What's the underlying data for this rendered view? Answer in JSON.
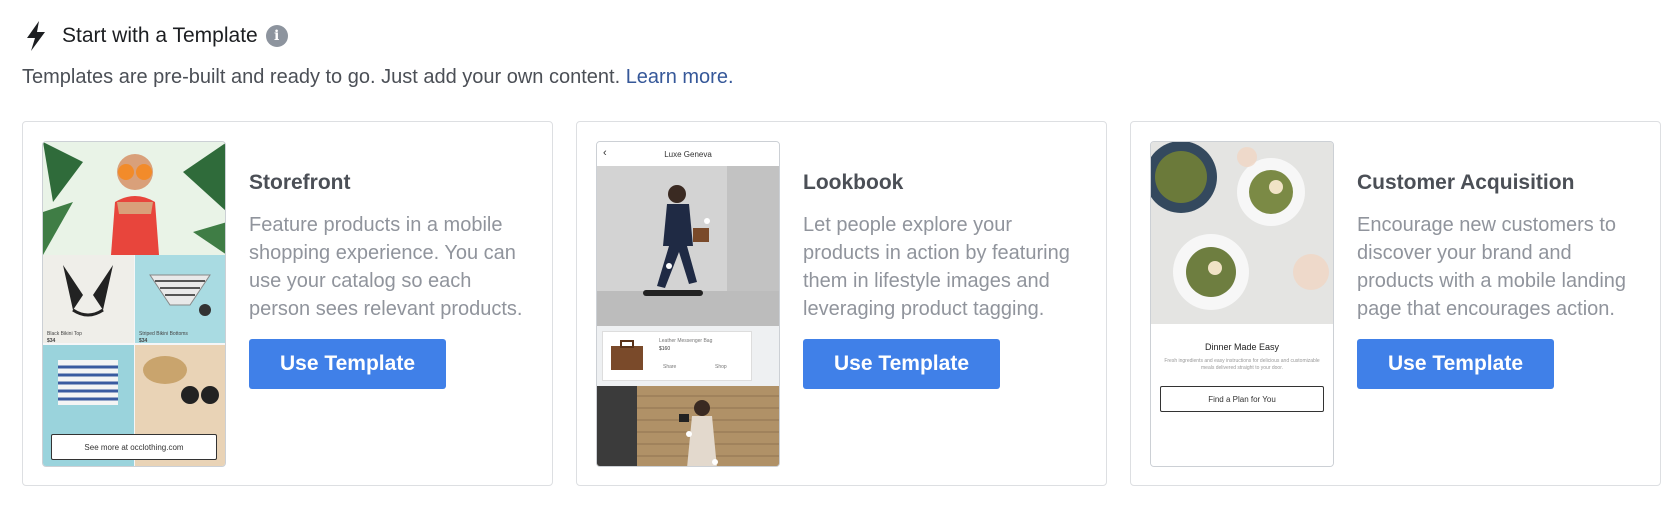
{
  "header": {
    "title": "Start with a Template",
    "info_icon": "info-icon",
    "bolt_icon": "lightning-bolt-icon"
  },
  "subtitle": {
    "text": "Templates are pre-built and ready to go. Just add your own content.",
    "link": "Learn more."
  },
  "colors": {
    "button": "#4080e8",
    "link": "#365899",
    "title": "#4b4f56",
    "desc": "#90949c"
  },
  "cards": [
    {
      "title": "Storefront",
      "description": "Feature products in a mobile shopping experience. You can use your catalog so each person sees relevant products.",
      "button": "Use Template",
      "preview": {
        "item1": "Black Bikini Top",
        "item1_price": "$34",
        "item2": "Striped Bikini Bottoms",
        "item2_price": "$34",
        "cta": "See more at occlothing.com"
      }
    },
    {
      "title": "Lookbook",
      "description": "Let people explore your products in action by featuring them in lifestyle images and leveraging product tagging.",
      "button": "Use Template",
      "preview": {
        "header": "Luxe Geneva",
        "product": "Leather Messenger Bag",
        "price": "$160",
        "share": "Share",
        "shop": "Shop"
      }
    },
    {
      "title": "Customer Acquisition",
      "description": "Encourage new customers to discover your brand and products with a mobile landing page that encourages action.",
      "button": "Use Template",
      "preview": {
        "heading": "Dinner Made Easy",
        "body": "Fresh ingredients and easy instructions for delicious and customizable meals delivered straight to your door.",
        "cta": "Find a Plan for You"
      }
    }
  ]
}
